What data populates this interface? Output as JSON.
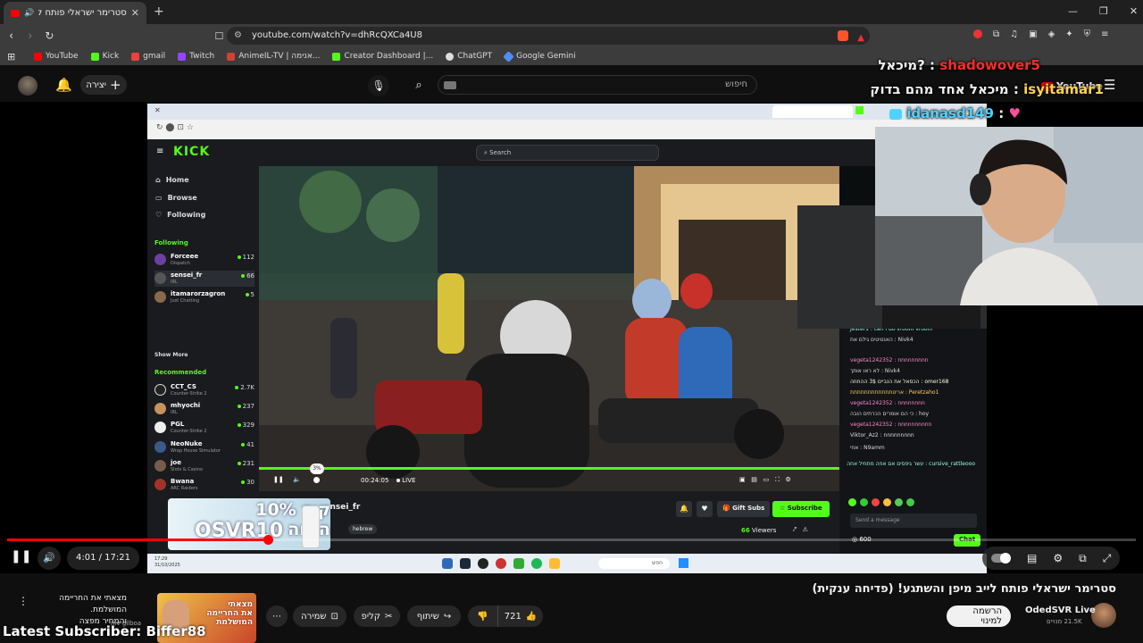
{
  "browser": {
    "tab_title": "סטרימר ישראלי פותח לייב מי...",
    "url": "youtube.com/watch?v=dhRcQXCa4U8",
    "bookmarks": [
      "YouTube",
      "Kick",
      "gmail",
      "Twitch",
      "AnimeIL-TV | אנימה...",
      "Creator Dashboard |...",
      "ChatGPT",
      "Google Gemini"
    ]
  },
  "youtube": {
    "search_placeholder": "חיפוש",
    "create_label": "יצירה",
    "time_display": "4:01 / 17:21",
    "progress": 0.231,
    "video_title": "סטרימר ישראלי פותח לייב מיפן והשתגע! (פדיחה ענקית)",
    "channel_name": "OdedSVR Live",
    "subscribers": "21.5K מנויים",
    "subscribe_label": "הרשמה למינוי",
    "likes": "721",
    "share_label": "שיתוף",
    "clip_label": "קליפ",
    "save_label": "שמירה",
    "promo_text_line1": "מצאתי את החריימה המושלמת.",
    "promo_text_line2": "והמחיר מפצה",
    "promo_channel": "niv gilboa"
  },
  "overlay": {
    "chat": [
      {
        "user": "shadowover5",
        "msg": "?מיכאל",
        "color": "#ff2b2b"
      },
      {
        "user": "isyitamar1",
        "msg": "מיכאל אחד מהם בדוק",
        "color": "#ffd34d"
      },
      {
        "user": "idanasd149",
        "msg": "",
        "color": "#4fd2ff"
      }
    ],
    "latest_subscriber": "Latest Subscriber: Biffer88",
    "promo_code_line1": "קוד 10% הנחה",
    "promo_code_line2": "OSVR10",
    "youtube_badge": "YouTube"
  },
  "kick": {
    "search_placeholder": "Search",
    "nav": [
      "Home",
      "Browse",
      "Following"
    ],
    "following_header": "Following",
    "following": [
      {
        "name": "Forceee",
        "sub": "Dispatch",
        "viewers": "112"
      },
      {
        "name": "sensei_fr",
        "sub": "IRL",
        "viewers": "66"
      },
      {
        "name": "itamarorzagron",
        "sub": "Just Chatting",
        "viewers": "5"
      }
    ],
    "show_more": "Show More",
    "recommended_header": "Recommended",
    "recommended": [
      {
        "name": "CCT_CS",
        "sub": "Counter-Strike 2",
        "viewers": "2.7K"
      },
      {
        "name": "mhyochi",
        "sub": "IRL",
        "viewers": "237"
      },
      {
        "name": "PGL",
        "sub": "Counter-Strike 2",
        "viewers": "329"
      },
      {
        "name": "NeoNuke",
        "sub": "Wrap House Simulator",
        "viewers": "41"
      },
      {
        "name": "joe",
        "sub": "Slots & Casino",
        "viewers": "231"
      },
      {
        "name": "Bwana",
        "sub": "ARC Raiders",
        "viewers": "30"
      }
    ],
    "stream_time": "00:24:05",
    "live_label": "LIVE",
    "volume_tip": "3%",
    "gift_subs": "Gift Subs",
    "subscribe": "Subscribe",
    "viewers": "66",
    "viewers_label": "Viewers",
    "streamer": "sensei_fr",
    "tag": "hebrew",
    "send_placeholder": "Send a message",
    "chat_button": "Chat",
    "points": "600",
    "chat_lines": [
      "Jester1 : can i do vroom vroom",
      "Nivk4 : האנטיטים גילם את",
      "vegeta1242352 : nnnnnnnnn",
      "Nivk4 : לא ראו אותך",
      "omer168 : הכסאל את הנביים 3$ ההחוזה",
      "Peretzaho1 : אריטתתתתתתתתתתתת",
      "vegeta1242352 : nnnnnnnn",
      "hoy : כי הם אומרים הכרתים הובה",
      "vegeta1242352 : nnnnnnnnnn",
      "Viktor_Az2 : nnnnnnnnn",
      "N9amm : אחי",
      "cursive_rattleooo : עשר גיפסים אם אחה מתחיל אחה"
    ],
    "taskbar_time": "17:29",
    "taskbar_date": "31/10/2025",
    "taskbar_search": "חפש"
  }
}
